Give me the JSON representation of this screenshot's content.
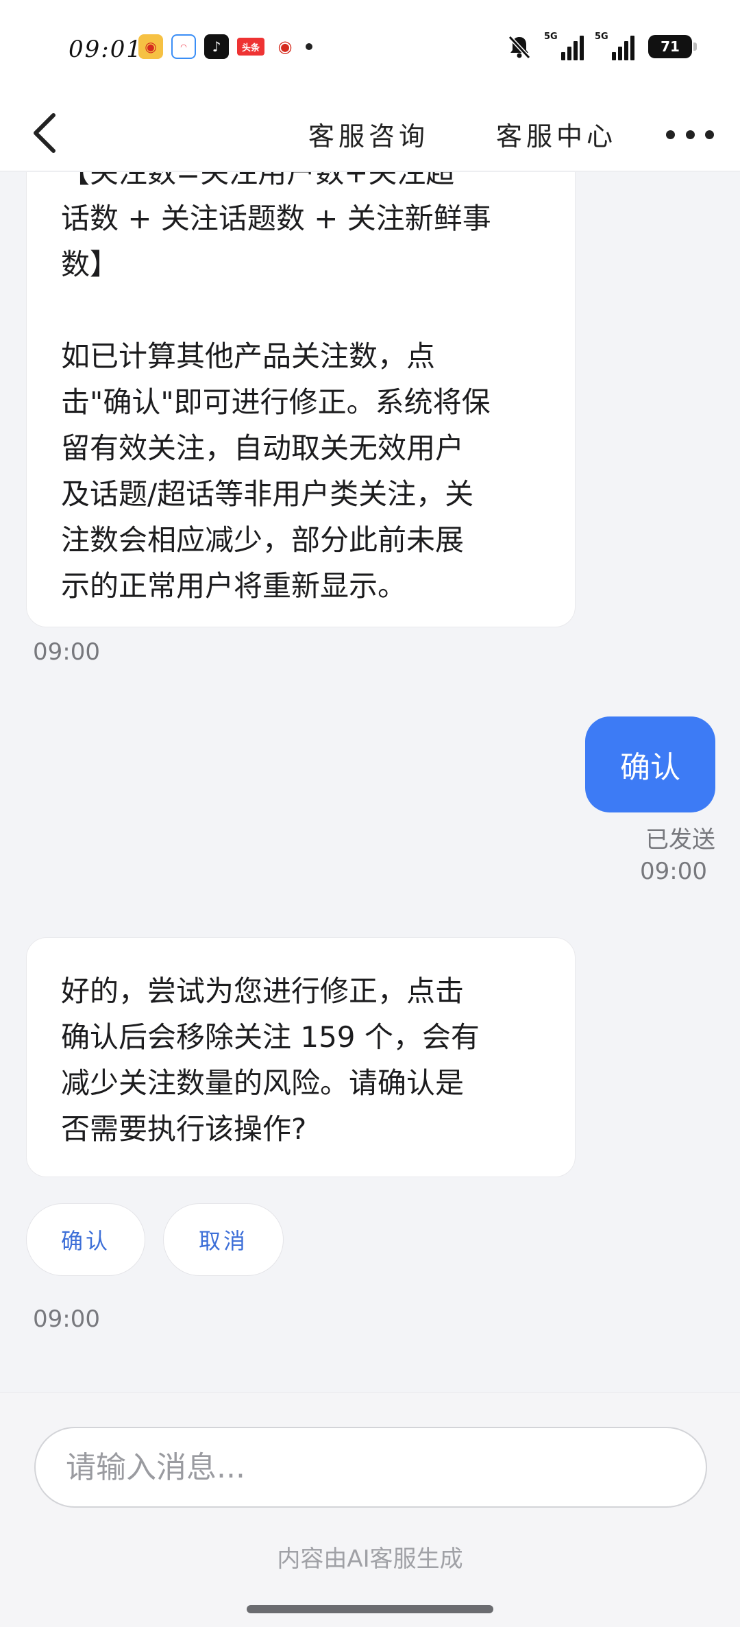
{
  "status_bar": {
    "time": "09:01",
    "apps": [
      {
        "icon": "weibo-icon",
        "glyph": "◉"
      },
      {
        "icon": "game-center-icon",
        "glyph": "◠"
      },
      {
        "icon": "tiktok-icon",
        "glyph": "♪"
      },
      {
        "icon": "toutiao-icon",
        "glyph": "头条"
      },
      {
        "icon": "weibo-icon",
        "glyph": "◉"
      }
    ],
    "network_1": "5G",
    "network_2": "5G",
    "battery": "71"
  },
  "nav": {
    "tab_consult": "客服咨询",
    "tab_center": "客服中心"
  },
  "messages": {
    "bubble_1": {
      "line_partial": "【关注数=关注用户数+关注超",
      "para_1": "话数 + 关注话题数 + 关注新鲜事\n数】",
      "para_2": "如已计算其他产品关注数，点\n击\"确认\"即可进行修正。系统将保\n留有效关注，自动取关无效用户\n及话题/超话等非用户类关注，关\n注数会相应减少，部分此前未展\n示的正常用户将重新显示。"
    },
    "time_1": "09:00",
    "outgoing_text": "确认",
    "sent_status": "已发送",
    "time_2": "09:00",
    "bubble_2": "好的，尝试为您进行修正，点击\n确认后会移除关注 159 个，会有\n减少关注数量的风险。请确认是\n否需要执行该操作?",
    "quick_replies": {
      "confirm": "确认",
      "cancel": "取消"
    },
    "time_3": "09:00"
  },
  "composer": {
    "placeholder": "请输入消息...",
    "footer_note": "内容由AI客服生成"
  },
  "colors": {
    "accent": "#3d7bf5",
    "chip_text": "#3d6fd8",
    "background": "#f3f4f7"
  }
}
